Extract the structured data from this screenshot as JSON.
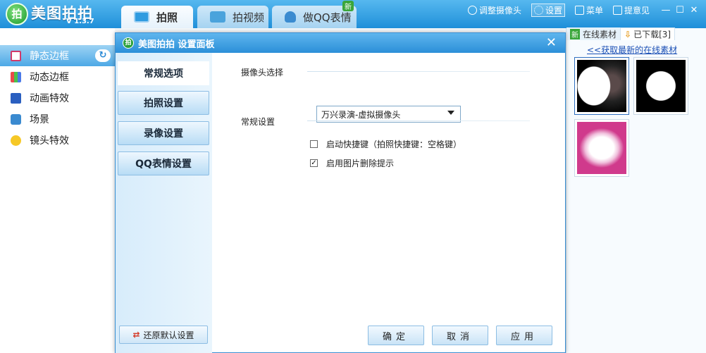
{
  "app": {
    "logo_char": "拍",
    "name": "美图拍拍",
    "version": "V 1.3.7"
  },
  "tabs": [
    {
      "label": "拍照",
      "icon": "camera-icon"
    },
    {
      "label": "拍视频",
      "icon": "video-camera-icon"
    },
    {
      "label": "做QQ表情",
      "icon": "penguin-icon",
      "badge": "新"
    }
  ],
  "top_actions": {
    "adjust_camera": "调整摄像头",
    "settings": "设置",
    "menu": "菜单",
    "feedback": "提意见"
  },
  "left_menu": [
    {
      "label": "静态边框",
      "icon": "static-frame-icon",
      "active": true
    },
    {
      "label": "动态边框",
      "icon": "dynamic-frame-icon"
    },
    {
      "label": "动画特效",
      "icon": "animation-icon"
    },
    {
      "label": "场景",
      "icon": "scene-icon"
    },
    {
      "label": "镜头特效",
      "icon": "smiley-icon"
    }
  ],
  "right_panel": {
    "tab_online_badge": "新",
    "tab_online": "在线素材",
    "tab_downloaded": "已下载[3]",
    "link": "<<获取最新的在线素材"
  },
  "dialog": {
    "logo_char": "拍",
    "title": "美图拍拍 设置面板",
    "side_tabs": [
      "常规选项",
      "拍照设置",
      "录像设置",
      "QQ表情设置"
    ],
    "restore": "还原默认设置",
    "camera_section": "摄像头选择",
    "camera_value": "万兴录演-虚拟摄像头",
    "general_section": "常规设置",
    "options": [
      {
        "label": "启动快捷键（拍照快捷键：空格键）",
        "checked": false
      },
      {
        "label": "启用图片删除提示",
        "checked": true
      }
    ],
    "buttons": {
      "ok": "确定",
      "cancel": "取消",
      "apply": "应用"
    }
  },
  "colors": {
    "titlebar": "#2b8fd8",
    "accent": "#4da9e6",
    "new_badge": "#3aa63a"
  }
}
